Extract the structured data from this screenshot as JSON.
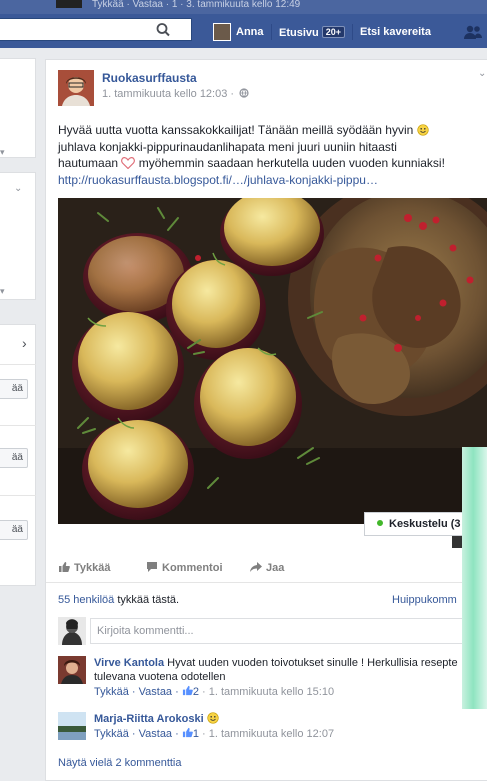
{
  "topbar": {
    "prev_comment_meta": "Tykkää · Vastaa · 1 · 3. tammikuuta kello 12:49",
    "search_value": "",
    "user_name": "Anna",
    "home_label": "Etusivu",
    "home_badge": "20+",
    "find_friends_label": "Etsi kavereita"
  },
  "left_column": {
    "like_button_label": "ää",
    "like_buttons": [
      "ää",
      "ää",
      "ää"
    ]
  },
  "post": {
    "author": "Ruokasurffausta",
    "timestamp": "1. tammikuuta kello 12:03 ·",
    "text_line1": "Hyvää uutta vuotta kanssakokkailijat! Tänään meillä syödään hyvin ",
    "text_line2": "juhlava konjakki-pippurinaudanlihapata meni juuri uuniin hitaasti",
    "text_line3a": "hautumaan ",
    "text_line3b": " myöhemmin saadaan herkutella uuden vuoden kunniaksi!",
    "link": "http://ruokasurffausta.blogspot.fi/…/juhlava-konjakki-pippu…",
    "chat_label": "Keskustelu (3",
    "actions": {
      "like": "Tykkää",
      "comment": "Kommentoi",
      "share": "Jaa"
    },
    "likes_link": "55 henkilöä",
    "likes_rest": " tykkää tästä.",
    "top_comments": "Huippukomm",
    "comment_placeholder": "Kirjoita kommentti...",
    "comments": [
      {
        "name": "Virve Kantola",
        "text": " Hyvat uuden vuoden toivotukset sinulle ! Herkullisia resepte",
        "text2": "tulevana vuotena odotellen",
        "meta_actions": "Tykkää · Vastaa · ",
        "likes": "2",
        "time": " · 1. tammikuuta kello 15:10"
      },
      {
        "name": "Marja-Riitta Arokoski",
        "text": "",
        "meta_actions": "Tykkää · Vastaa · ",
        "likes": "1",
        "time": " · 1. tammikuuta kello 12:07"
      }
    ],
    "more_comments": "Näytä vielä 2 kommenttia"
  },
  "colors": {
    "brand": "#3b5998",
    "link": "#365899",
    "online": "#42b72a"
  }
}
